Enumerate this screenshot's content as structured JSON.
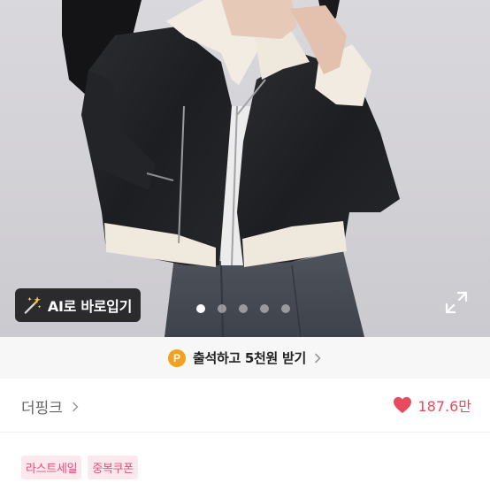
{
  "product_image": {
    "ai_button_label": "AI로 바로입기",
    "carousel": {
      "total": 5,
      "active_index": 0
    }
  },
  "attendance_banner": {
    "coin_letter": "P",
    "text": "출석하고 5천원 받기"
  },
  "shop": {
    "name": "더핑크",
    "likes": "187.6만"
  },
  "badges": [
    "라스트세일",
    "중복쿠폰"
  ],
  "colors": {
    "accent_pink": "#e84b60",
    "badge_text": "#e94b7a",
    "badge_bg": "#fde8ee",
    "coin": "#f4a11d"
  }
}
